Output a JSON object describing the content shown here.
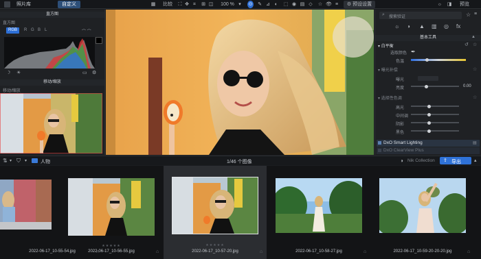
{
  "topbar": {
    "tab_library": "照片库",
    "tab_custom": "自定义",
    "compare_label": "比较",
    "zoom_label": "100 %",
    "settings_label": "预设设置",
    "preview_label": "预览"
  },
  "left_panel": {
    "histogram_title": "直方图",
    "histogram_sub": "直方图",
    "channels": [
      "RGB",
      "R",
      "G",
      "B",
      "L"
    ],
    "navigator_title": "移动/缩放",
    "navigator_sub": "移动/缩放"
  },
  "right_panel": {
    "search_placeholder": "搜索验证",
    "basic_tools_title": "基本工具",
    "white_balance": "白平衡",
    "pick_color": "选取颜色",
    "color_label": "色温",
    "exposure_section": "曝光补偿",
    "exposure_rows": [
      {
        "label": "曝光",
        "value": ""
      },
      {
        "label": "亮度",
        "value": "0.00"
      }
    ],
    "tone_section": "选择性色调",
    "tone_rows": [
      "高光",
      "中间调",
      "阴影",
      "黑色"
    ],
    "smart_lighting": "DxO Smart Lighting",
    "clearview": "DxO ClearView Plus"
  },
  "bottom_bar": {
    "folder_label": "人物",
    "count_label": "1/46 个图像",
    "nik_label": "Nik Collection",
    "export_label": "导出"
  },
  "filmstrip": [
    {
      "name": "2022-06-17_10-55-54.jpg",
      "selected": false
    },
    {
      "name": "2022-06-17_10-56-55.jpg",
      "selected": false
    },
    {
      "name": "2022-06-17_10-57-20.jpg",
      "selected": true
    },
    {
      "name": "2022-06-17_10-58-27.jpg",
      "selected": false
    },
    {
      "name": "2022-06-17_10-59-20-20-20.jpg",
      "selected": false
    }
  ],
  "icons": [
    "search-icon",
    "star-icon",
    "gear-icon",
    "eye-icon",
    "folder-icon",
    "camera-icon",
    "crop-icon",
    "hand-icon",
    "pipette-icon"
  ],
  "colors": {
    "accent": "#2d6fd6",
    "panel_bg": "#1f2124",
    "export_btn": "#2f72d8"
  }
}
